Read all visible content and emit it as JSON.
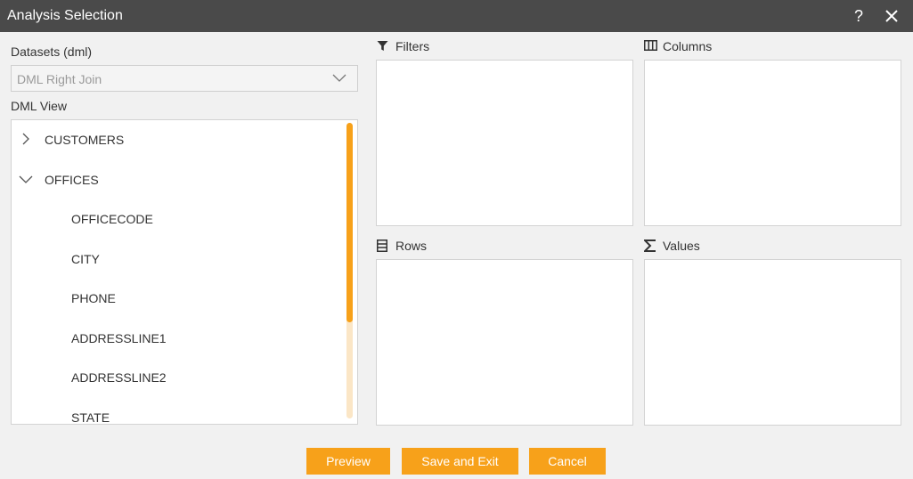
{
  "window": {
    "title": "Analysis Selection",
    "help_glyph": "?"
  },
  "datasets": {
    "label": "Datasets (dml)",
    "selected": "DML Right Join"
  },
  "dml_view": {
    "label": "DML View",
    "groups": [
      {
        "label": "CUSTOMERS",
        "expanded": false
      },
      {
        "label": "OFFICES",
        "expanded": true
      }
    ],
    "fields": [
      "OFFICECODE",
      "CITY",
      "PHONE",
      "ADDRESSLINE1",
      "ADDRESSLINE2",
      "STATE"
    ]
  },
  "zones": {
    "filters": {
      "label": "Filters",
      "icon": "filter-icon"
    },
    "columns": {
      "label": "Columns",
      "icon": "columns-icon"
    },
    "rows": {
      "label": "Rows",
      "icon": "rows-icon"
    },
    "values": {
      "label": "Values",
      "icon": "sigma-icon"
    }
  },
  "buttons": {
    "preview": "Preview",
    "save_exit": "Save and Exit",
    "cancel": "Cancel"
  },
  "colors": {
    "accent": "#f7a11a",
    "titlebar": "#4a4a4a",
    "background": "#f1f1f1"
  }
}
